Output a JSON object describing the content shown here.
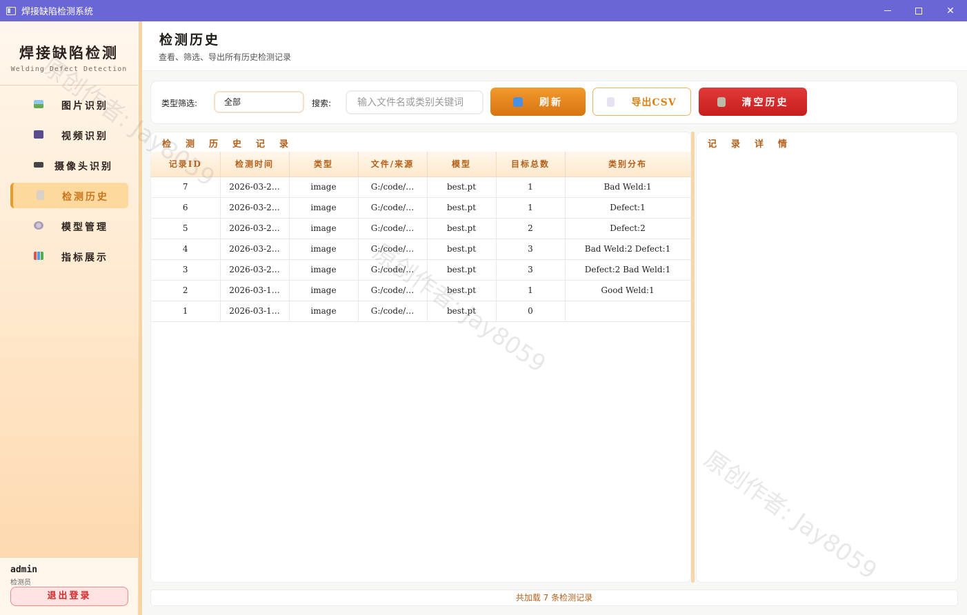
{
  "window": {
    "title": "焊接缺陷检测系统"
  },
  "sidebar": {
    "brand_title": "焊接缺陷检测",
    "brand_subtitle": "Welding Defect Detection",
    "items": [
      {
        "label": "图片识别",
        "icon": "image-icon"
      },
      {
        "label": "视频识别",
        "icon": "video-icon"
      },
      {
        "label": "摄像头识别",
        "icon": "camera-icon"
      },
      {
        "label": "检测历史",
        "icon": "history-icon",
        "active": true
      },
      {
        "label": "模型管理",
        "icon": "gear-icon"
      },
      {
        "label": "指标展示",
        "icon": "bar-chart-icon"
      }
    ],
    "user": {
      "name": "admin",
      "role": "检测员",
      "logout_label": "退出登录"
    }
  },
  "header": {
    "title": "检测历史",
    "subtitle": "查看、筛选、导出所有历史检测记录"
  },
  "toolbar": {
    "type_filter_label": "类型筛选:",
    "type_filter_value": "全部",
    "search_label": "搜索:",
    "search_placeholder": "输入文件名或类别关键词",
    "refresh_label": "刷新",
    "export_label": "导出CSV",
    "clear_label": "清空历史"
  },
  "records_panel": {
    "title": "检测历史记录",
    "columns": [
      "记录ID",
      "检测时间",
      "类型",
      "文件/来源",
      "模型",
      "目标总数",
      "类别分布"
    ],
    "rows": [
      [
        "7",
        "2026-03-2…",
        "image",
        "G:/code/…",
        "best.pt",
        "1",
        "Bad Weld:1"
      ],
      [
        "6",
        "2026-03-2…",
        "image",
        "G:/code/…",
        "best.pt",
        "1",
        "Defect:1"
      ],
      [
        "5",
        "2026-03-2…",
        "image",
        "G:/code/…",
        "best.pt",
        "2",
        "Defect:2"
      ],
      [
        "4",
        "2026-03-2…",
        "image",
        "G:/code/…",
        "best.pt",
        "3",
        "Bad Weld:2  Defect:1"
      ],
      [
        "3",
        "2026-03-2…",
        "image",
        "G:/code/…",
        "best.pt",
        "3",
        "Defect:2  Bad Weld:1"
      ],
      [
        "2",
        "2026-03-1…",
        "image",
        "G:/code/…",
        "best.pt",
        "1",
        "Good Weld:1"
      ],
      [
        "1",
        "2026-03-1…",
        "image",
        "G:/code/…",
        "best.pt",
        "0",
        ""
      ]
    ]
  },
  "detail_panel": {
    "title": "记录详情"
  },
  "status": {
    "text": "共加载 7 条检测记录"
  },
  "watermark": {
    "text": "原创作者: Jay8059"
  }
}
